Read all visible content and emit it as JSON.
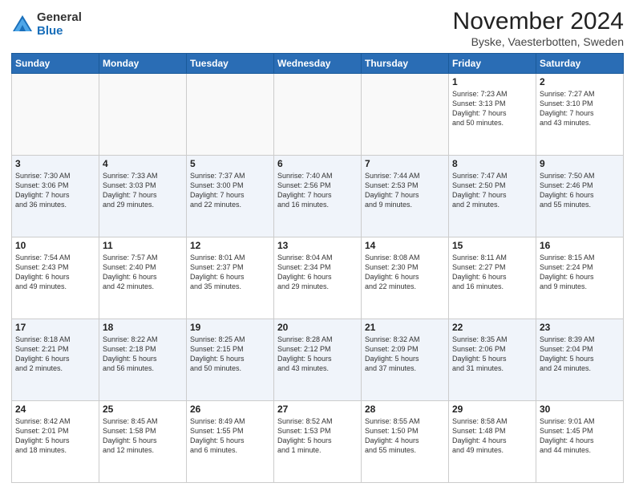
{
  "logo": {
    "general": "General",
    "blue": "Blue"
  },
  "title": "November 2024",
  "location": "Byske, Vaesterbotten, Sweden",
  "headers": [
    "Sunday",
    "Monday",
    "Tuesday",
    "Wednesday",
    "Thursday",
    "Friday",
    "Saturday"
  ],
  "weeks": [
    {
      "alt": false,
      "days": [
        {
          "num": "",
          "info": ""
        },
        {
          "num": "",
          "info": ""
        },
        {
          "num": "",
          "info": ""
        },
        {
          "num": "",
          "info": ""
        },
        {
          "num": "",
          "info": ""
        },
        {
          "num": "1",
          "info": "Sunrise: 7:23 AM\nSunset: 3:13 PM\nDaylight: 7 hours\nand 50 minutes."
        },
        {
          "num": "2",
          "info": "Sunrise: 7:27 AM\nSunset: 3:10 PM\nDaylight: 7 hours\nand 43 minutes."
        }
      ]
    },
    {
      "alt": true,
      "days": [
        {
          "num": "3",
          "info": "Sunrise: 7:30 AM\nSunset: 3:06 PM\nDaylight: 7 hours\nand 36 minutes."
        },
        {
          "num": "4",
          "info": "Sunrise: 7:33 AM\nSunset: 3:03 PM\nDaylight: 7 hours\nand 29 minutes."
        },
        {
          "num": "5",
          "info": "Sunrise: 7:37 AM\nSunset: 3:00 PM\nDaylight: 7 hours\nand 22 minutes."
        },
        {
          "num": "6",
          "info": "Sunrise: 7:40 AM\nSunset: 2:56 PM\nDaylight: 7 hours\nand 16 minutes."
        },
        {
          "num": "7",
          "info": "Sunrise: 7:44 AM\nSunset: 2:53 PM\nDaylight: 7 hours\nand 9 minutes."
        },
        {
          "num": "8",
          "info": "Sunrise: 7:47 AM\nSunset: 2:50 PM\nDaylight: 7 hours\nand 2 minutes."
        },
        {
          "num": "9",
          "info": "Sunrise: 7:50 AM\nSunset: 2:46 PM\nDaylight: 6 hours\nand 55 minutes."
        }
      ]
    },
    {
      "alt": false,
      "days": [
        {
          "num": "10",
          "info": "Sunrise: 7:54 AM\nSunset: 2:43 PM\nDaylight: 6 hours\nand 49 minutes."
        },
        {
          "num": "11",
          "info": "Sunrise: 7:57 AM\nSunset: 2:40 PM\nDaylight: 6 hours\nand 42 minutes."
        },
        {
          "num": "12",
          "info": "Sunrise: 8:01 AM\nSunset: 2:37 PM\nDaylight: 6 hours\nand 35 minutes."
        },
        {
          "num": "13",
          "info": "Sunrise: 8:04 AM\nSunset: 2:34 PM\nDaylight: 6 hours\nand 29 minutes."
        },
        {
          "num": "14",
          "info": "Sunrise: 8:08 AM\nSunset: 2:30 PM\nDaylight: 6 hours\nand 22 minutes."
        },
        {
          "num": "15",
          "info": "Sunrise: 8:11 AM\nSunset: 2:27 PM\nDaylight: 6 hours\nand 16 minutes."
        },
        {
          "num": "16",
          "info": "Sunrise: 8:15 AM\nSunset: 2:24 PM\nDaylight: 6 hours\nand 9 minutes."
        }
      ]
    },
    {
      "alt": true,
      "days": [
        {
          "num": "17",
          "info": "Sunrise: 8:18 AM\nSunset: 2:21 PM\nDaylight: 6 hours\nand 2 minutes."
        },
        {
          "num": "18",
          "info": "Sunrise: 8:22 AM\nSunset: 2:18 PM\nDaylight: 5 hours\nand 56 minutes."
        },
        {
          "num": "19",
          "info": "Sunrise: 8:25 AM\nSunset: 2:15 PM\nDaylight: 5 hours\nand 50 minutes."
        },
        {
          "num": "20",
          "info": "Sunrise: 8:28 AM\nSunset: 2:12 PM\nDaylight: 5 hours\nand 43 minutes."
        },
        {
          "num": "21",
          "info": "Sunrise: 8:32 AM\nSunset: 2:09 PM\nDaylight: 5 hours\nand 37 minutes."
        },
        {
          "num": "22",
          "info": "Sunrise: 8:35 AM\nSunset: 2:06 PM\nDaylight: 5 hours\nand 31 minutes."
        },
        {
          "num": "23",
          "info": "Sunrise: 8:39 AM\nSunset: 2:04 PM\nDaylight: 5 hours\nand 24 minutes."
        }
      ]
    },
    {
      "alt": false,
      "days": [
        {
          "num": "24",
          "info": "Sunrise: 8:42 AM\nSunset: 2:01 PM\nDaylight: 5 hours\nand 18 minutes."
        },
        {
          "num": "25",
          "info": "Sunrise: 8:45 AM\nSunset: 1:58 PM\nDaylight: 5 hours\nand 12 minutes."
        },
        {
          "num": "26",
          "info": "Sunrise: 8:49 AM\nSunset: 1:55 PM\nDaylight: 5 hours\nand 6 minutes."
        },
        {
          "num": "27",
          "info": "Sunrise: 8:52 AM\nSunset: 1:53 PM\nDaylight: 5 hours\nand 1 minute."
        },
        {
          "num": "28",
          "info": "Sunrise: 8:55 AM\nSunset: 1:50 PM\nDaylight: 4 hours\nand 55 minutes."
        },
        {
          "num": "29",
          "info": "Sunrise: 8:58 AM\nSunset: 1:48 PM\nDaylight: 4 hours\nand 49 minutes."
        },
        {
          "num": "30",
          "info": "Sunrise: 9:01 AM\nSunset: 1:45 PM\nDaylight: 4 hours\nand 44 minutes."
        }
      ]
    }
  ]
}
